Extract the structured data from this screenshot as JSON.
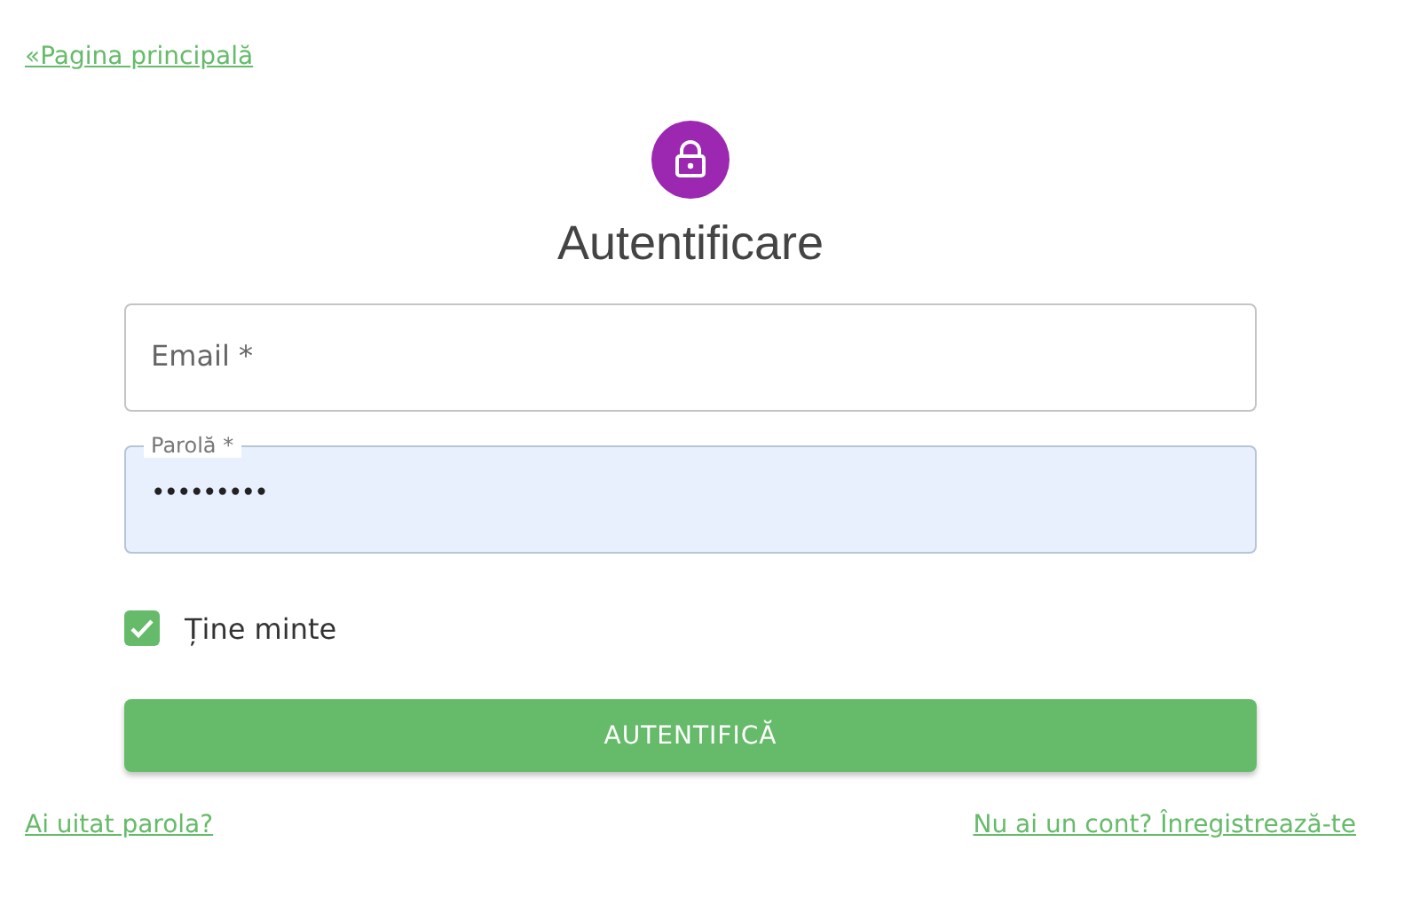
{
  "back_link": "«Pagina principală",
  "title": "Autentificare",
  "fields": [
    {
      "label": "Email *",
      "autofilled": false
    },
    {
      "label": "Parolă *",
      "value": "•••••••••",
      "autofilled": true
    }
  ],
  "remember": {
    "label": "Ține minte",
    "checked": true
  },
  "submit": "AUTENTIFICĂ",
  "links": [
    "Ai uitat parola?",
    "Nu ai un cont? Înregistrează-te"
  ]
}
